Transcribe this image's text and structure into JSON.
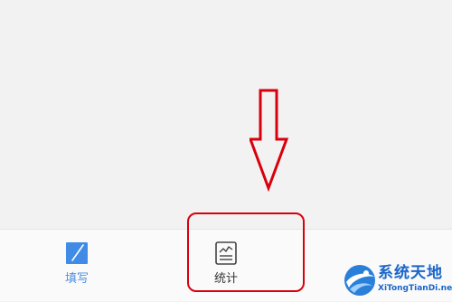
{
  "tabbar": {
    "tabs": [
      {
        "label": "填写",
        "icon": "edit-pen-icon",
        "active": true
      },
      {
        "label": "统计",
        "icon": "stats-chart-icon",
        "active": false
      }
    ]
  },
  "annotation": {
    "arrow_color": "#d9000d",
    "box_color": "#d9000d"
  },
  "watermark": {
    "title": "系统天地",
    "url": "XiTongTianDi.net"
  },
  "colors": {
    "accent": "#4a90e2",
    "watermark": "#1a66c9",
    "background": "#f2f2f2"
  }
}
